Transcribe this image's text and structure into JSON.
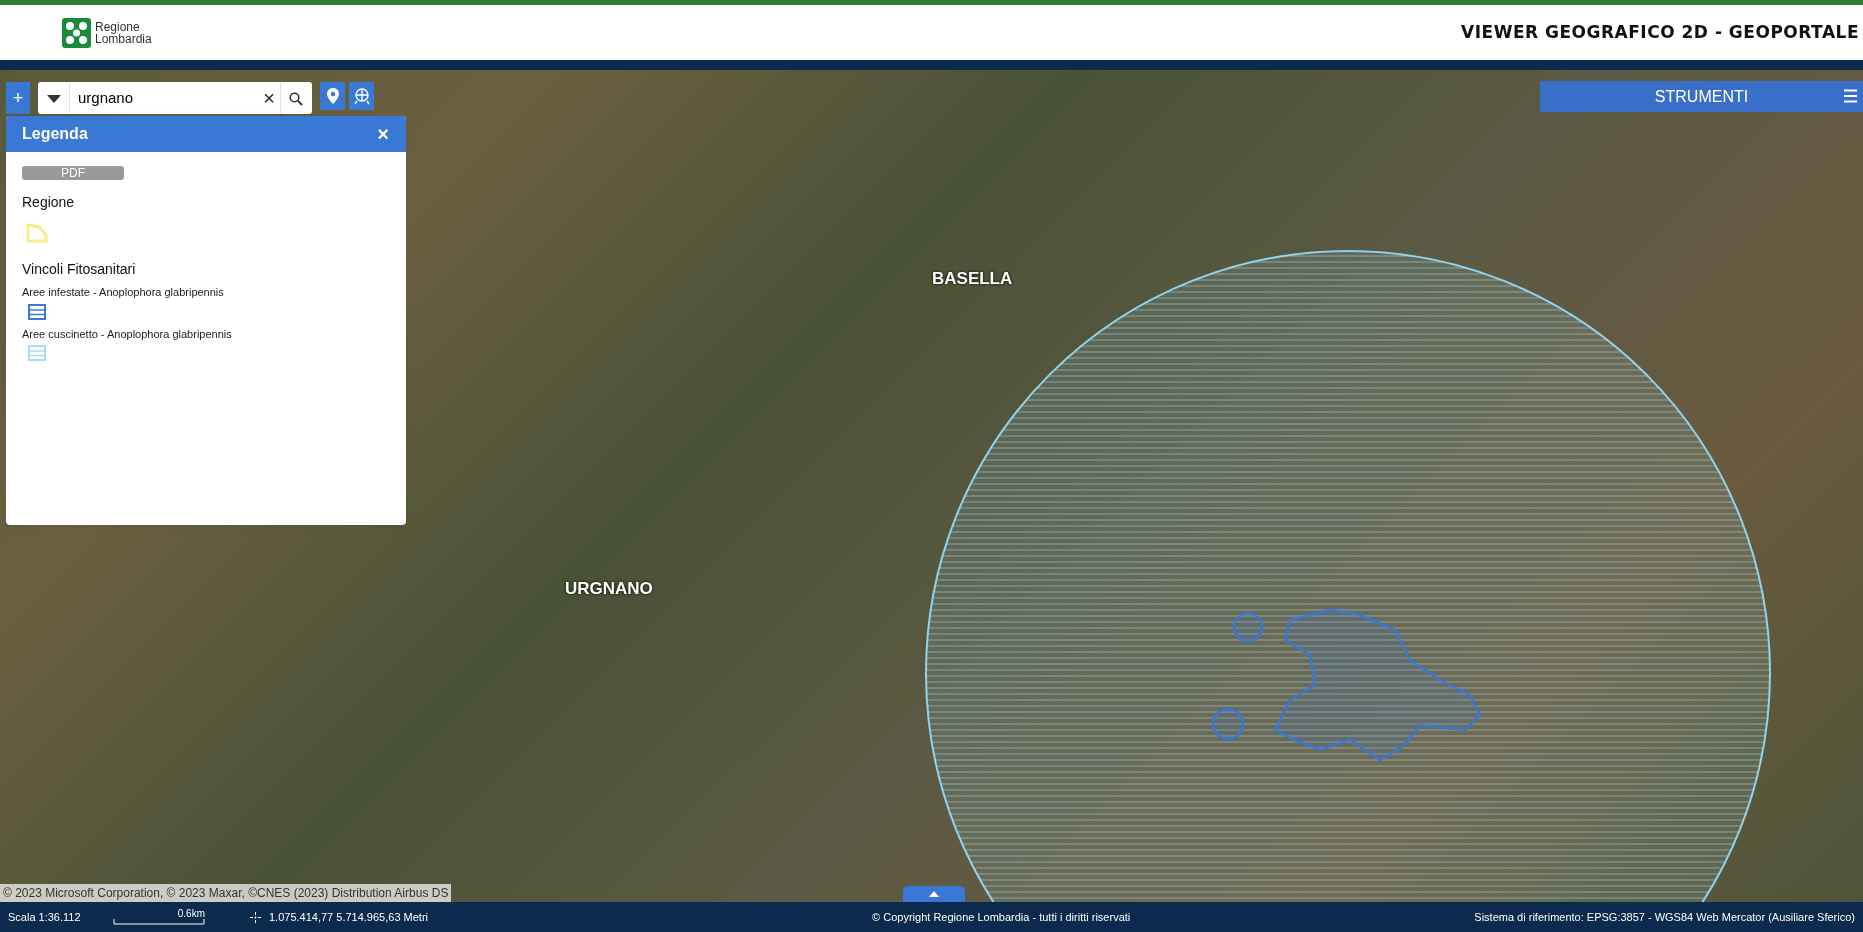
{
  "header": {
    "logo_lines": [
      "Regione",
      "Lombardia"
    ],
    "title": "VIEWER GEOGRAFICO 2D - GEOPORTALE"
  },
  "toolbar": {
    "zoom_in": "+",
    "search_value": "urgnano",
    "clear": "×"
  },
  "legend": {
    "title": "Legenda",
    "close": "×",
    "pdf_button": "PDF",
    "groups": [
      {
        "title": "Regione",
        "items": [
          {
            "kind": "outline",
            "color": "#f5ee8a"
          }
        ]
      },
      {
        "title": "Vincoli Fitosanitari",
        "items": [
          {
            "kind": "hatch",
            "label": "Aree infestate - Anoplophora glabripennis",
            "color": "#3a78d6"
          },
          {
            "kind": "hatch",
            "label": "Aree cuscinetto - Anoplophora glabripennis",
            "color": "#a8dcef"
          }
        ]
      }
    ]
  },
  "tools_panel": {
    "title": "STRUMENTI"
  },
  "map": {
    "labels": [
      "BASELLA",
      "URGNANO"
    ],
    "attribution": "© 2023 Microsoft Corporation, © 2023 Maxar, ©CNES (2023) Distribution Airbus DS"
  },
  "status_bar": {
    "scale": "Scala 1:36.112",
    "scale_bar": "0.6km",
    "coordinates": "1.075.414,77 5.714.965,63 Metri",
    "copyright": "© Copyright Regione Lombardia - tutti i diritti riservati",
    "crs": "Sistema di riferimento: EPSG:3857 - WGS84 Web Mercator (Ausiliare Sferico)"
  }
}
